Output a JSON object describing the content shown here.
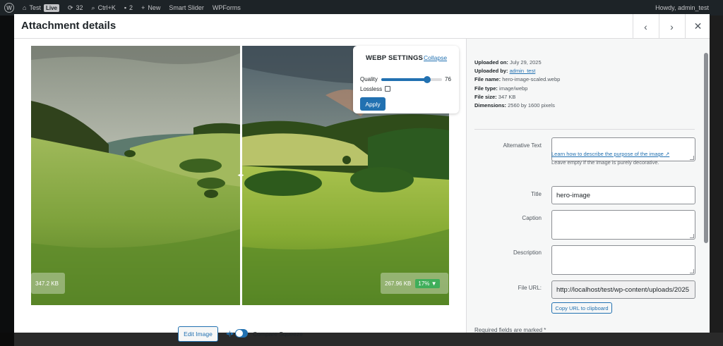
{
  "admin_bar": {
    "site_name": "Test",
    "live_badge": "Live",
    "update_count": "32",
    "command_palette": "Ctrl+K",
    "comment_count": "2",
    "new_label": "New",
    "smart_slider": "Smart Slider",
    "wpforms": "WPForms",
    "greeting": "Howdy, admin_test"
  },
  "modal": {
    "title": "Attachment details",
    "prev_icon": "chevron-left-icon",
    "next_icon": "chevron-right-icon",
    "close_icon": "close-icon"
  },
  "compare": {
    "original_size": "347.2 KB",
    "compressed_size": "267.96 KB",
    "savings": "17%",
    "savings_color": "#3fae5a"
  },
  "webp": {
    "title": "WEBP SETTINGS",
    "collapse": "Collapse",
    "quality_label": "Quality",
    "quality_value": "76",
    "quality_fraction": 0.76,
    "lossless_label": "Lossless",
    "lossless_checked": false,
    "apply": "Apply"
  },
  "image_actions": {
    "edit_image": "Edit Image",
    "compare_label": "Compare Squeeze",
    "compare_enabled": true
  },
  "details": {
    "uploaded_on_label": "Uploaded on:",
    "uploaded_on": "July 29, 2025",
    "uploaded_by_label": "Uploaded by:",
    "uploaded_by": "admin_test",
    "file_name_label": "File name:",
    "file_name": "hero-image-scaled.webp",
    "file_type_label": "File type:",
    "file_type": "image/webp",
    "file_size_label": "File size:",
    "file_size": "347 KB",
    "dimensions_label": "Dimensions:",
    "dimensions": "2560 by 1600 pixels"
  },
  "form": {
    "alt_label": "Alternative Text",
    "alt_value": "",
    "alt_help_link": "Learn how to describe the purpose of the image",
    "alt_help_text": "Leave empty if the image is purely decorative.",
    "title_label": "Title",
    "title_value": "hero-image",
    "caption_label": "Caption",
    "caption_value": "",
    "description_label": "Description",
    "description_value": "",
    "file_url_label": "File URL:",
    "file_url_value": "http://localhost/test/wp-content/uploads/2025",
    "copy_url": "Copy URL to clipboard",
    "required_note": "Required fields are marked *"
  },
  "colors": {
    "accent": "#2271b1",
    "admin_bar": "#1d2327"
  }
}
